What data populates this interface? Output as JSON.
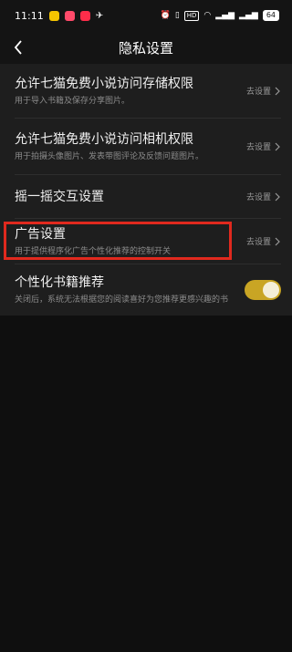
{
  "status_bar": {
    "time": "11:11",
    "network_badge": "HD",
    "battery": "64"
  },
  "header": {
    "back_icon": "chevron-left-icon",
    "title": "隐私设置"
  },
  "settings": [
    {
      "title": "允许七猫免费小说访问存储权限",
      "desc": "用于导入书籍及保存分享图片。",
      "action": "去设置"
    },
    {
      "title": "允许七猫免费小说访问相机权限",
      "desc": "用于拍摄头像图片、发表带图评论及反馈问题图片。",
      "action": "去设置"
    },
    {
      "title": "摇一摇交互设置",
      "action": "去设置"
    },
    {
      "title": "广告设置",
      "desc": "用于提供程序化广告个性化推荐的控制开关",
      "action": "去设置"
    },
    {
      "title": "个性化书籍推荐",
      "desc": "关闭后，系统无法根据您的阅读喜好为您推荐更感兴趣的书",
      "toggle_on": true
    }
  ],
  "colors": {
    "accent": "#c9a524",
    "highlight": "#e0291e",
    "background": "#0f0f0f",
    "panel": "#1e1e1e"
  }
}
